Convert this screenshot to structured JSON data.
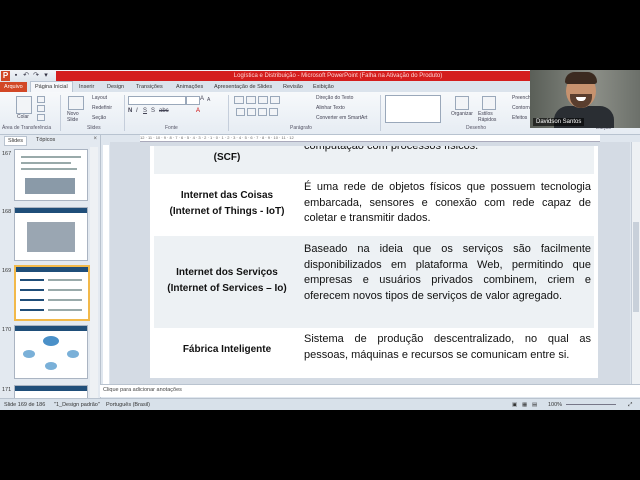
{
  "window": {
    "title": "Logística e Distribuição - Microsoft PowerPoint (Falha na Ativação do Produto)"
  },
  "ribbon_tabs": [
    "Arquivo",
    "Página Inicial",
    "Inserir",
    "Design",
    "Transições",
    "Animações",
    "Apresentação de Slides",
    "Revisão",
    "Exibição"
  ],
  "ribbon": {
    "clipboard": {
      "paste": "Colar",
      "label": "Área de Transferência"
    },
    "slides": {
      "new_slide": "Novo Slide",
      "layout": "Layout",
      "reset": "Redefinir",
      "section": "Seção",
      "label": "Slides"
    },
    "font": {
      "label": "Fonte"
    },
    "paragraph": {
      "text_direction": "Direção do Texto",
      "align_text": "Alinhar Texto",
      "smartart": "Converter em SmartArt",
      "label": "Parágrafo"
    },
    "drawing": {
      "arrange": "Organizar",
      "quick_styles": "Estilos Rápidos",
      "fill": "Preench",
      "outline": "Contorn",
      "effects": "Efeitos",
      "label": "Desenho"
    },
    "editing": {
      "label": "Edição"
    }
  },
  "slides_pane": {
    "tabs": [
      "Slides",
      "Tópicos"
    ],
    "thumbnails": [
      {
        "number": "167"
      },
      {
        "number": "168"
      },
      {
        "number": "169"
      },
      {
        "number": "170"
      },
      {
        "number": "171"
      }
    ]
  },
  "slide": {
    "rows": [
      {
        "term": "(SCF)",
        "description": "computação com processos físicos."
      },
      {
        "term": "Internet das Coisas\n(Internet of Things - IoT)",
        "description": "É uma rede de objetos físicos que possuem tecnologia embarcada, sensores e conexão com rede capaz de coletar e transmitir dados."
      },
      {
        "term": "Internet dos Serviços\n(Internet of Services – Io)",
        "description": "Baseado na ideia que os serviços são facilmente disponibilizados em plataforma Web, permitindo que empresas e usuários privados combinem, criem e oferecem novos tipos de serviços de valor agregado."
      },
      {
        "term": "Fábrica Inteligente",
        "description": "Sistema de produção descentralizado, no qual as pessoas, máquinas e recursos se comunicam entre si."
      }
    ]
  },
  "notes": {
    "placeholder": "Clique para adicionar anotações"
  },
  "status_bar": {
    "slide_info": "Slide 169 de 186",
    "theme": "\"1_Design padrão\"",
    "language": "Português (Brasil)",
    "zoom": "100%"
  },
  "webcam": {
    "name": "Davidson Santos"
  }
}
